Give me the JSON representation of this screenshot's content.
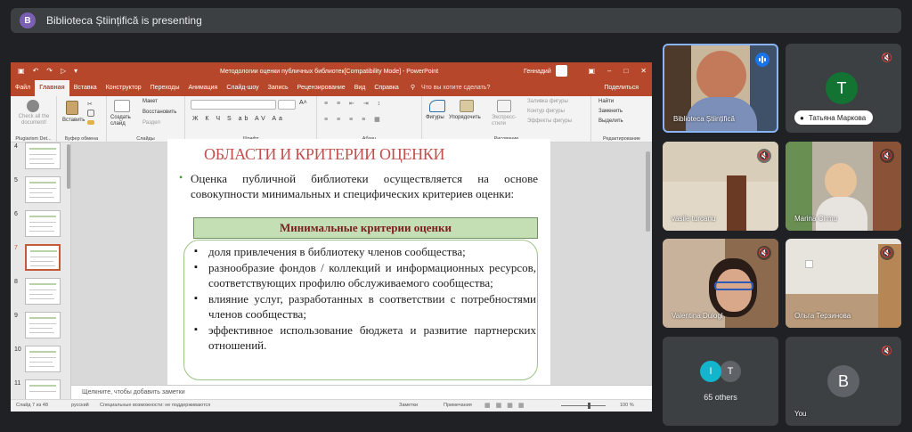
{
  "meeting": {
    "presenter_initial": "B",
    "presenting_text": "Biblioteca Științifică is presenting"
  },
  "powerpoint": {
    "window_title": "Методологии оценки публичных библиотек[Compatibility Mode] - PowerPoint",
    "user_name": "Геннадий",
    "tabs": [
      "Файл",
      "Главная",
      "Вставка",
      "Конструктор",
      "Переходы",
      "Анимация",
      "Слайд-шоу",
      "Запись",
      "Рецензирование",
      "Вид",
      "Справка"
    ],
    "active_tab": "Главная",
    "tell_me": "Что вы хотите сделать?",
    "share": "Поделиться",
    "ribbon": {
      "plugin_label": "Check all the document!",
      "plugin_group": "Plugiarism Det...",
      "paste": "Вставить",
      "clipboard_group": "Буфер обмена",
      "new_slide": "Создать слайд",
      "layout": "Макет",
      "restore": "Восстановить",
      "section": "Раздел",
      "slides_group": "Слайды",
      "font_group": "Шрифт",
      "paragraph_group": "Абзац",
      "shapes": "Фигуры",
      "arrange": "Упорядочить",
      "express_styles": "Экспресс-стили",
      "shape_fill": "Заливка фигуры",
      "shape_outline": "Контур фигуры",
      "shape_effects": "Эффекты фигуры",
      "drawing_group": "Рисование",
      "find": "Найти",
      "replace": "Заменить",
      "select": "Выделить",
      "editing_group": "Редактирование"
    },
    "thumbnails": [
      "4",
      "5",
      "6",
      "7",
      "8",
      "9",
      "10",
      "11"
    ],
    "selected_slide": "7",
    "slide": {
      "title": "ОБЛАСТИ И КРИТЕРИИ ОЦЕНКИ",
      "intro": "Оценка публичной библиотеки осуществляется на основе совокупности минимальных и специфических критериев оценки:",
      "box_title": "Минимальные критерии оценки",
      "items": [
        "доля привлечения в библиотеку членов сообщества;",
        "разнообразие фондов / коллекций и информационных ресурсов, соответствующих профилю обслуживаемого сообщества;",
        "влияние услуг, разработанных в соответствии с потребностями членов сообщества;",
        "эффективное использование бюджета и развитие партнерских отношений."
      ]
    },
    "notes_placeholder": "Щелкните, чтобы добавить заметки",
    "status": {
      "slide_counter": "Слайд 7 из 48",
      "language": "русский",
      "accessibility": "Специальные возможности: не поддерживаются",
      "notes": "Заметки",
      "comments": "Примечания",
      "zoom": "100 %"
    }
  },
  "participants": [
    {
      "name": "Biblioteca Științifică"
    },
    {
      "name": "Татьяна Маркова",
      "initial": "T",
      "color": "#137333"
    },
    {
      "name": "vasile turcanu"
    },
    {
      "name": "Marina Cirmu"
    },
    {
      "name": "Valentina Dulogl"
    },
    {
      "name": "Ольга Терзинова"
    },
    {
      "name": "65 others",
      "avatars": [
        "I",
        "T"
      ]
    },
    {
      "name": "You",
      "initial": "B",
      "color": "#5f6368"
    }
  ]
}
